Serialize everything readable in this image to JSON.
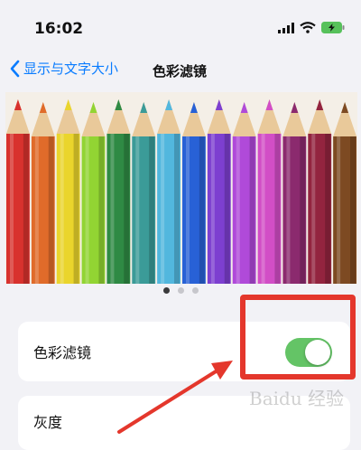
{
  "status_bar": {
    "time": "16:02"
  },
  "nav": {
    "back_label": "显示与文字大小",
    "title": "色彩滤镜"
  },
  "pencils": {
    "colors": [
      "#d8322e",
      "#e06b2a",
      "#ead52c",
      "#92d433",
      "#2f8a44",
      "#3b9b98",
      "#52b7de",
      "#2861d6",
      "#7d3fd0",
      "#b04ad9",
      "#d24ec6",
      "#8b2a6e",
      "#93243f",
      "#7d4a22"
    ]
  },
  "page_dots": {
    "count": 3,
    "active_index": 0
  },
  "cells": {
    "color_filter": {
      "label": "色彩滤镜",
      "toggle_on": true
    },
    "grayscale": {
      "label": "灰度"
    }
  },
  "watermark": {
    "text": "Baidu 经验"
  },
  "colors": {
    "accent": "#0a7cff",
    "toggle_on": "#64c466",
    "annotation_red": "#e4372c"
  }
}
